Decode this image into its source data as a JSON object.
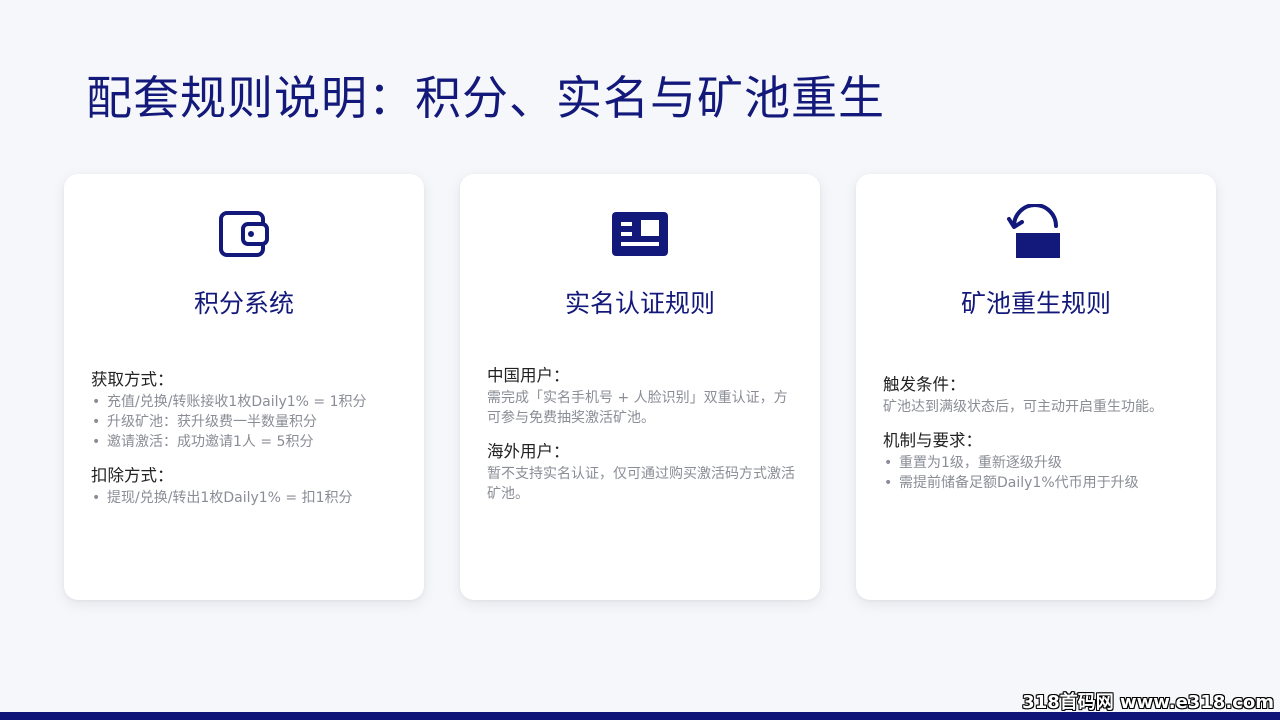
{
  "title": "配套规则说明：积分、实名与矿池重生",
  "accent_color": "#13197a",
  "cards": [
    {
      "icon": "wallet-icon",
      "title": "积分系统",
      "sections": [
        {
          "heading": "获取方式：",
          "bullets": [
            "充值/兑换/转账接收1枚Daily1% = 1积分",
            "升级矿池：获升级费一半数量积分",
            "邀请激活：成功邀请1人 = 5积分"
          ]
        },
        {
          "heading": "扣除方式：",
          "bullets": [
            "提现/兑换/转出1枚Daily1% = 扣1积分"
          ]
        }
      ]
    },
    {
      "icon": "id-card-icon",
      "title": "实名认证规则",
      "sections": [
        {
          "heading": "中国用户：",
          "text": "需完成「实名手机号 + 人脸识别」双重认证，方可参与免费抽奖激活矿池。"
        },
        {
          "heading": "海外用户：",
          "text": "暂不支持实名认证，仅可通过购买激活码方式激活矿池。"
        }
      ]
    },
    {
      "icon": "reset-icon",
      "title": "矿池重生规则",
      "sections": [
        {
          "heading": "触发条件：",
          "text": "矿池达到满级状态后，可主动开启重生功能。"
        },
        {
          "heading": "机制与要求：",
          "bullets": [
            "重置为1级，重新逐级升级",
            "需提前储备足额Daily1%代币用于升级"
          ]
        }
      ]
    }
  ],
  "watermark": "318首码网 www.e318.com"
}
